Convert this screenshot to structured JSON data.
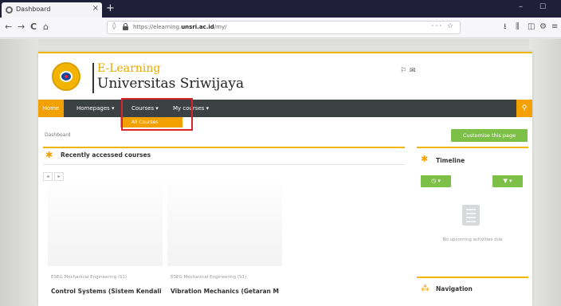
{
  "browser": {
    "tab_title": "Dashboard",
    "tab_close": "×",
    "new_tab": "+",
    "back": "←",
    "forward": "→",
    "reload": "C",
    "home": "⌂",
    "url_prefix": "https://elearning.",
    "url_domain": "unsri.ac.id",
    "url_path": "/my/",
    "url_actions": "··· ☆",
    "minimize": "–",
    "maximize": "☐"
  },
  "site": {
    "brand_line1": "E-Learning",
    "brand_line2": "Universitas Sriwijaya"
  },
  "menu": {
    "home": "Home",
    "homepages": "Homepages ▾",
    "courses": "Courses ▾",
    "my_courses": "My courses ▾",
    "dropdown_item": "All Courses"
  },
  "page": {
    "breadcrumb": "Dashboard",
    "customize_button": "Customise this page"
  },
  "recent_courses": {
    "title": "Recently accessed courses",
    "prev": "◂",
    "next": "▸",
    "courses": [
      {
        "category": "ESEG Mechanical Engineering (S1)",
        "name": "Control Systems (Sistem Kendali"
      },
      {
        "category": "ESEG Mechanical Engineering (S1)",
        "name": "Vibration Mechanics (Getaran M"
      }
    ]
  },
  "timeline": {
    "title": "Timeline",
    "sort_button": "◷ ▾",
    "filter_button": "▼ ▾",
    "empty_text": "No upcoming activities due"
  },
  "navigation": {
    "title": "Navigation"
  }
}
